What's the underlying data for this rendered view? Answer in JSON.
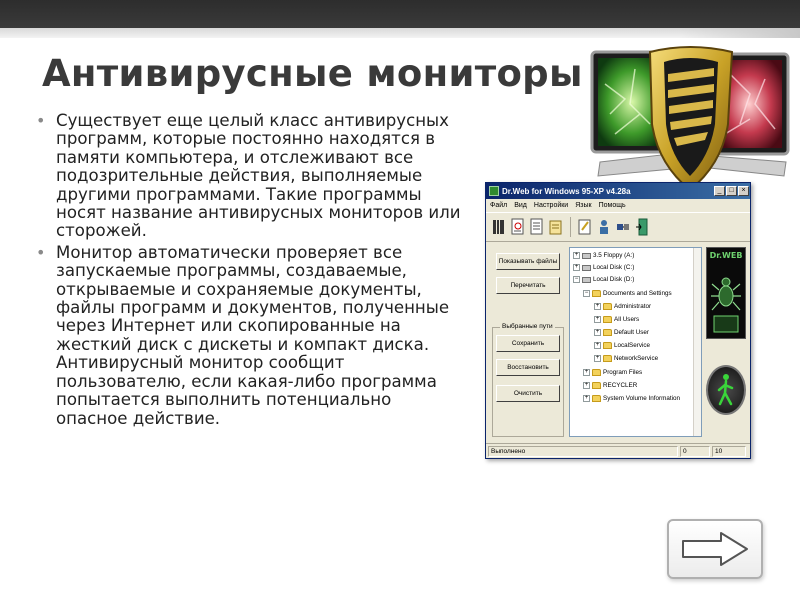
{
  "slide": {
    "title": "Антивирусные мониторы",
    "bullets": [
      "Существует еще целый класс антивирусных программ, которые постоянно находятся в памяти компьютера, и отслеживают все подозрительные действия, выполняемые другими программами. Такие программы носят название антивирусных мониторов или сторожей.",
      "Монитор автоматически проверяет все запускаемые программы, создаваемые, открываемые и сохраняемые документы, файлы программ и документов, полученные через Интернет или скопированные на жесткий диск с дискеты и компакт диска. Антивирусный монитор сообщит пользователю, если какая-либо программа попытается выполнить потенциально опасное действие."
    ],
    "bullet_marker": "•"
  },
  "app_window": {
    "title": "Dr.Web for Windows 95-XP v4.28a",
    "window_controls": [
      "_",
      "□",
      "×"
    ],
    "menu": [
      "Файл",
      "Вид",
      "Настройки",
      "Язык",
      "Помощь"
    ],
    "buttons": {
      "show_files": "Показывать файлы",
      "reread": "Перечитать",
      "save": "Сохранить",
      "restore": "Восстановить",
      "clear": "Очистить"
    },
    "group_label": "Выбранные пути",
    "tree": [
      {
        "label": "3.5 Floppy (A:)",
        "type": "drive",
        "level": 0
      },
      {
        "label": "Local Disk (C:)",
        "type": "drive",
        "level": 0
      },
      {
        "label": "Local Disk (D:)",
        "type": "drive",
        "level": 0
      },
      {
        "label": "Documents and Settings",
        "type": "folder",
        "level": 1
      },
      {
        "label": "Administrator",
        "type": "folder",
        "level": 2
      },
      {
        "label": "All Users",
        "type": "folder",
        "level": 2
      },
      {
        "label": "Default User",
        "type": "folder",
        "level": 2
      },
      {
        "label": "LocalService",
        "type": "folder",
        "level": 2
      },
      {
        "label": "NetworkService",
        "type": "folder",
        "level": 2
      },
      {
        "label": "Program Files",
        "type": "folder",
        "level": 1
      },
      {
        "label": "RECYCLER",
        "type": "folder",
        "level": 1
      },
      {
        "label": "System Volume Information",
        "type": "folder",
        "level": 1
      }
    ],
    "logo_text": "Dr.WEB",
    "status": {
      "text": "Выполнено",
      "count_a": "0",
      "count_b": "10"
    }
  },
  "colors": {
    "title": "#3a3a3a",
    "titlebar": "#0a246a",
    "shield_gold": "#c9a227"
  },
  "icons": [
    "shield-icon",
    "next-arrow-icon"
  ]
}
